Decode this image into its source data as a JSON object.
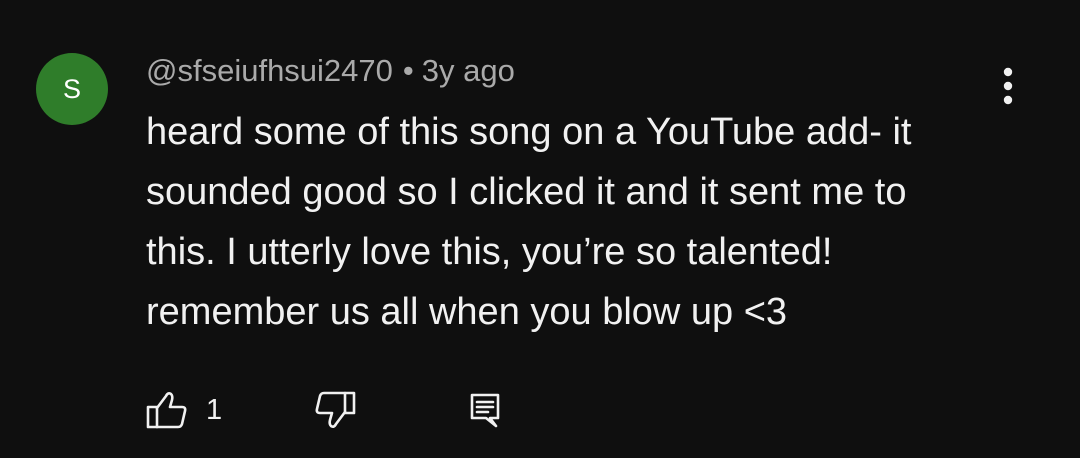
{
  "comment": {
    "avatar_letter": "S",
    "avatar_color": "#2f7d2a",
    "author": "@sfseiufhsui2470",
    "separator": "•",
    "timestamp": "3y ago",
    "text_lines": [
      "heard some of this song on a YouTube add- it",
      "sounded good so I clicked it and it sent me to",
      "this. I utterly love this, you’re so talented!",
      "remember us all when you blow up <3"
    ],
    "like_count": "1"
  },
  "icons": {
    "menu": "more-vertical-icon",
    "like": "thumbs-up-icon",
    "dislike": "thumbs-down-icon",
    "reply": "reply-comment-icon"
  },
  "colors": {
    "background": "#0f0f0f",
    "primary_text": "#f1f1f1",
    "secondary_text": "#aaaaaa"
  }
}
